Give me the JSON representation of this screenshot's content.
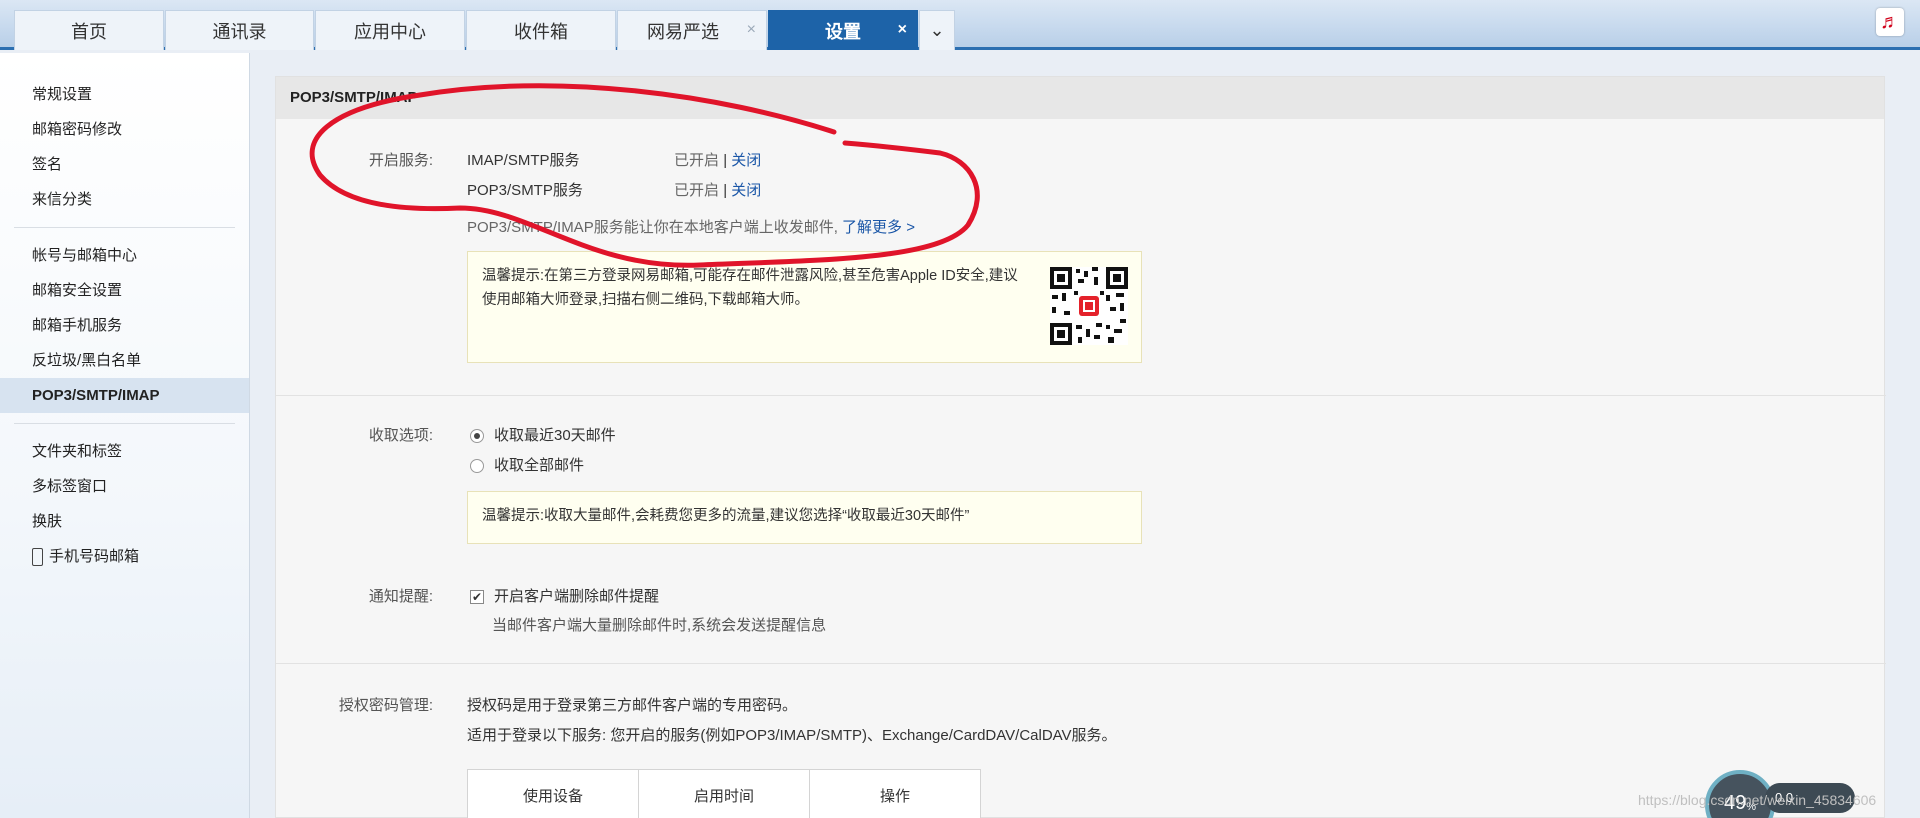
{
  "tabs": [
    {
      "label": "首页",
      "closable": false,
      "active": false
    },
    {
      "label": "通讯录",
      "closable": false,
      "active": false
    },
    {
      "label": "应用中心",
      "closable": false,
      "active": false
    },
    {
      "label": "收件箱",
      "closable": false,
      "active": false
    },
    {
      "label": "网易严选",
      "closable": true,
      "active": false
    },
    {
      "label": "设置",
      "closable": true,
      "active": true
    }
  ],
  "tab_close_glyph": "×",
  "tab_more_glyph": "⌄",
  "music_glyph": "♬",
  "sidebar": {
    "group1": [
      "常规设置",
      "邮箱密码修改",
      "签名",
      "来信分类"
    ],
    "group2": [
      "帐号与邮箱中心",
      "邮箱安全设置",
      "邮箱手机服务",
      "反垃圾/黑白名单",
      "POP3/SMTP/IMAP"
    ],
    "active_item": "POP3/SMTP/IMAP",
    "group3": [
      "文件夹和标签",
      "多标签窗口",
      "换肤",
      "手机号码邮箱"
    ]
  },
  "main": {
    "header": "POP3/SMTP/IMAP",
    "services": {
      "label": "开启服务:",
      "rows": [
        {
          "name": "IMAP/SMTP服务",
          "status": "已开启",
          "sep": "|",
          "action": "关闭"
        },
        {
          "name": "POP3/SMTP服务",
          "status": "已开启",
          "sep": "|",
          "action": "关闭"
        }
      ],
      "desc": "POP3/SMTP/IMAP服务能让你在本地客户端上收发邮件,",
      "more_link": "了解更多 >",
      "tip": "温馨提示:在第三方登录网易邮箱,可能存在邮件泄露风险,甚至危害Apple ID安全,建议使用邮箱大师登录,扫描右侧二维码,下载邮箱大师。"
    },
    "fetch": {
      "label": "收取选项:",
      "options": [
        {
          "label": "收取最近30天邮件",
          "selected": true
        },
        {
          "label": "收取全部邮件",
          "selected": false
        }
      ],
      "tip": "温馨提示:收取大量邮件,会耗费您更多的流量,建议您选择“收取最近30天邮件”"
    },
    "notify": {
      "label": "通知提醒:",
      "checkbox_label": "开启客户端删除邮件提醒",
      "checked": true,
      "check_glyph": "✔",
      "desc": "当邮件客户端大量删除邮件时,系统会发送提醒信息"
    },
    "auth": {
      "label": "授权密码管理:",
      "line1": "授权码是用于登录第三方邮件客户端的专用密码。",
      "line2": "适用于登录以下服务: 您开启的服务(例如POP3/IMAP/SMTP)、Exchange/CardDAV/CalDAV服务。",
      "columns": [
        "使用设备",
        "启用时间",
        "操作"
      ]
    }
  },
  "overlay": {
    "gauge_value": "49",
    "gauge_unit": "%",
    "speed": "0.0",
    "watermark": "https://blog.csdn.net/weixin_45834606"
  },
  "colors": {
    "active_tab": "#1d63a8",
    "link": "#1a56a7",
    "scribble": "#e0142a"
  }
}
